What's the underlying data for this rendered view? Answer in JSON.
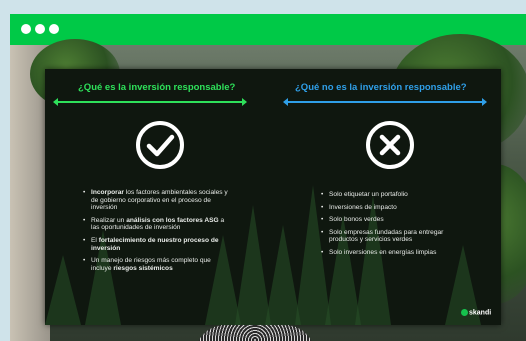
{
  "window": {
    "titlebar_color": "#00c947",
    "controls": [
      "dot",
      "dot",
      "dot"
    ]
  },
  "slide": {
    "left": {
      "heading": "¿Qué es la inversión responsable?",
      "icon": "check-circle-icon",
      "accent": "#2ee05a",
      "bullets": [
        {
          "parts": [
            {
              "b": true,
              "t": "Incorporar"
            },
            {
              "b": false,
              "t": " los factores ambientales sociales y de gobierno corporativo en el proceso de inversión"
            }
          ]
        },
        {
          "parts": [
            {
              "b": false,
              "t": "Realizar un "
            },
            {
              "b": true,
              "t": "análisis con los factores ASG"
            },
            {
              "b": false,
              "t": " a las oportunidades de inversión"
            }
          ]
        },
        {
          "parts": [
            {
              "b": false,
              "t": "El "
            },
            {
              "b": true,
              "t": "fortalecimiento de nuestro proceso de inversión"
            }
          ]
        },
        {
          "parts": [
            {
              "b": false,
              "t": "Un manejo de riesgos más completo que incluye "
            },
            {
              "b": true,
              "t": "riesgos sistémicos"
            }
          ]
        }
      ]
    },
    "right": {
      "heading": "¿Qué no es la inversión responsable?",
      "icon": "x-circle-icon",
      "accent": "#2f9fe8",
      "bullets": [
        "Solo etiquetar un portafolio",
        "Inversiones de impacto",
        "Solo bonos verdes",
        "Solo empresas fundadas para entregar productos y servicios verdes",
        "Solo inversiones en energías limpias"
      ]
    },
    "logo_text": "skandi"
  }
}
